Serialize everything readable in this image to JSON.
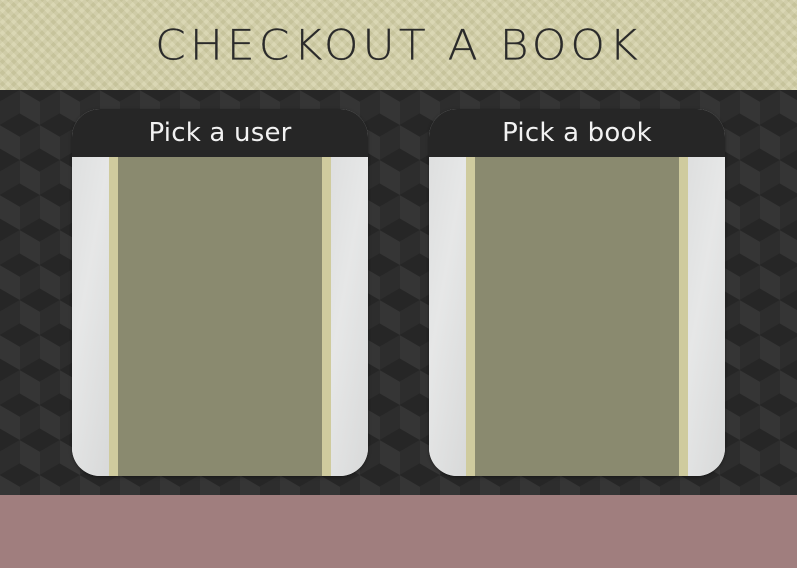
{
  "header": {
    "title": "CHECKOUT A BOOK"
  },
  "user_picker": {
    "title": "Pick a user",
    "items": []
  },
  "book_picker": {
    "title": "Pick a book",
    "items": []
  },
  "colors": {
    "header_bg": "#d3cfa5",
    "main_bg": "#2d2d2d",
    "footer_bg": "#a07e7e",
    "panel_header_bg": "#262626",
    "list_bg": "#8a8a6f",
    "list_border": "#cfcb9e",
    "panel_side": "#dddfdf"
  }
}
